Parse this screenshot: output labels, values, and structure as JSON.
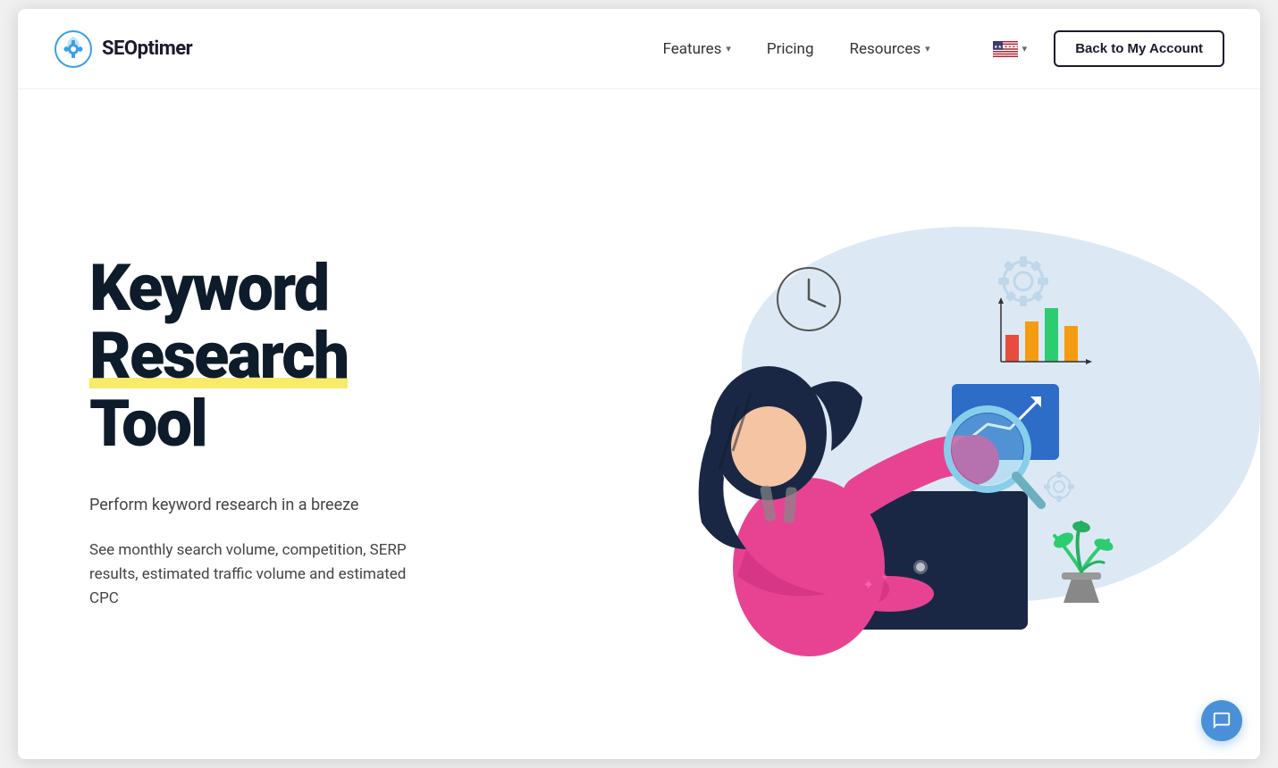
{
  "logo": {
    "text": "SEOptimer",
    "icon_name": "seoptimer-logo-icon"
  },
  "nav": {
    "links": [
      {
        "label": "Features",
        "has_dropdown": true
      },
      {
        "label": "Pricing",
        "has_dropdown": false
      },
      {
        "label": "Resources",
        "has_dropdown": true
      }
    ],
    "back_button_label": "Back to My Account",
    "flag_alt": "US Flag"
  },
  "hero": {
    "title_line1": "Keyword",
    "title_line2": "Research",
    "title_line3": "Tool",
    "subtitle": "Perform keyword research in a breeze",
    "description": "See monthly search volume, competition, SERP results, estimated traffic volume and estimated CPC"
  },
  "colors": {
    "accent_yellow": "#f5e642",
    "nav_border": "#0d1b2a",
    "brand_blue": "#4a90d9",
    "text_dark": "#0d1b2a",
    "text_medium": "#444444",
    "blob": "#dce9f5"
  }
}
